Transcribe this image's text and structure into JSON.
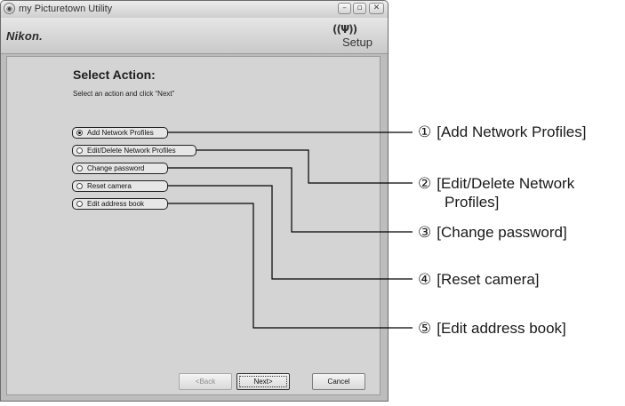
{
  "window": {
    "title": "my Picturetown Utility",
    "brand": "Nikon.",
    "setup_icon_glyph": "((Ψ))",
    "setup_label": "Setup",
    "controls": {
      "minimize": "–",
      "maximize": "▫",
      "close": "✕"
    }
  },
  "page": {
    "heading": "Select Action:",
    "instruction": "Select an action and click “Next”"
  },
  "options": [
    {
      "label": "Add Network Profiles",
      "selected": true
    },
    {
      "label": "Edit/Delete Network Profiles",
      "selected": false
    },
    {
      "label": "Change password",
      "selected": false
    },
    {
      "label": "Reset camera",
      "selected": false
    },
    {
      "label": "Edit address book",
      "selected": false
    }
  ],
  "buttons": {
    "back": "<Back",
    "next": "Next>",
    "cancel": "Cancel"
  },
  "callouts": [
    {
      "number": "①",
      "text": "[Add Network Profiles]"
    },
    {
      "number": "②",
      "text": "[Edit/Delete Network",
      "text_line2": "Profiles]"
    },
    {
      "number": "③",
      "text": "[Change password]"
    },
    {
      "number": "④",
      "text": "[Reset camera]"
    },
    {
      "number": "⑤",
      "text": "[Edit address book]"
    }
  ],
  "colors": {
    "window_bg": "#bdbdbd",
    "panel_bg": "#d4d4d4",
    "leader_line": "#000000"
  },
  "icons": {
    "app": "camera-globe-icon",
    "setup": "wireless-antenna-icon"
  }
}
